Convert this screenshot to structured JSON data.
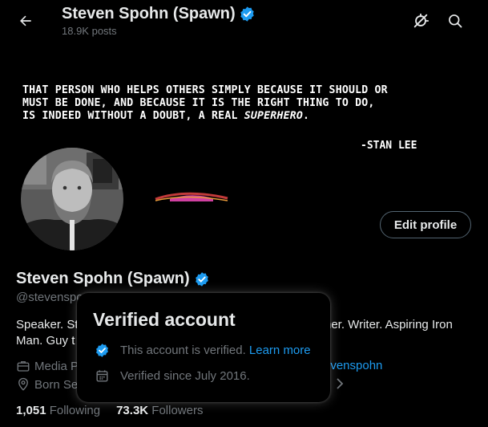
{
  "header": {
    "title": "Steven Spohn (Spawn)",
    "post_count": "18.9K posts"
  },
  "banner": {
    "quote_lines": [
      "THAT PERSON WHO HELPS OTHERS SIMPLY BECAUSE IT SHOULD OR",
      "MUST BE DONE, AND BECAUSE IT IS THE RIGHT THING TO DO,"
    ],
    "quote_line3_prefix": "IS INDEED WITHOUT A DOUBT, A REAL ",
    "quote_hero": "SUPERHERO",
    "quote_end": ".",
    "signature": "-STAN LEE"
  },
  "profile": {
    "edit_label": "Edit profile",
    "name": "Steven Spohn (Spawn)",
    "handle": "@stevenspo",
    "bio_line1_start": "Speaker. St",
    "bio_line1_end": "her. Writer. Aspiring Iron",
    "bio_line2_start": "Man. Guy t",
    "category": "Media P",
    "website_fragment": "evenspohn",
    "born": "Born Se",
    "following_count": "1,051",
    "following_label": "Following",
    "followers_count": "73.3K",
    "followers_label": "Followers"
  },
  "popover": {
    "title": "Verified account",
    "verified_text": "This account is verified.",
    "learn_more": "Learn more",
    "verified_since": "Verified since July 2016."
  },
  "colors": {
    "accent": "#1d9bf0",
    "background": "#000000",
    "text_primary": "#e7e9ea",
    "text_secondary": "#71767b"
  },
  "icons": [
    "back-arrow-icon",
    "verified-badge-icon",
    "mute-icon",
    "search-icon",
    "briefcase-icon",
    "location-icon",
    "calendar-icon",
    "chevron-right-icon"
  ]
}
